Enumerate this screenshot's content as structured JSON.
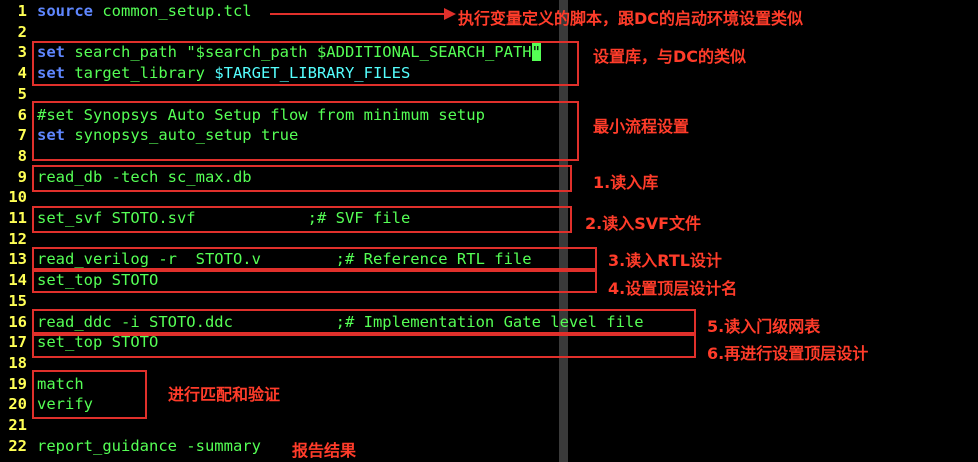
{
  "lines": [
    {
      "num": "1",
      "kw": "source",
      "text": " common_setup.tcl"
    },
    {
      "num": "2"
    },
    {
      "num": "3",
      "kw": "set",
      "text": " search_path ",
      "str": "\"$search_path $ADDITIONAL_SEARCH_PATH",
      "cursor": "\""
    },
    {
      "num": "4",
      "kw": "set",
      "text": " target_library ",
      "var": "$TARGET_LIBRARY_FILES"
    },
    {
      "num": "5"
    },
    {
      "num": "6",
      "text": "#set Synopsys Auto Setup flow from minimum setup"
    },
    {
      "num": "7",
      "kw": "set",
      "text": " synopsys_auto_setup true"
    },
    {
      "num": "8"
    },
    {
      "num": "9",
      "text": "read_db -tech sc_max.db"
    },
    {
      "num": "10"
    },
    {
      "num": "11",
      "text": "set_svf STOTO.svf            ;# SVF file"
    },
    {
      "num": "12"
    },
    {
      "num": "13",
      "text": "read_verilog -r  STOTO.v        ;# Reference RTL file"
    },
    {
      "num": "14",
      "text": "set_top STOTO"
    },
    {
      "num": "15"
    },
    {
      "num": "16",
      "text": "read_ddc -i STOTO.ddc           ;# Implementation Gate level file"
    },
    {
      "num": "17",
      "text": "set_top STOTO"
    },
    {
      "num": "18"
    },
    {
      "num": "19",
      "text": "match"
    },
    {
      "num": "20",
      "text": "verify"
    },
    {
      "num": "21"
    },
    {
      "num": "22",
      "text": "report_guidance -summary"
    }
  ],
  "annotations": {
    "a1": "执行变量定义的脚本，跟DC的启动环境设置类似",
    "a3": "设置库，与DC的类似",
    "a6": "最小流程设置",
    "a9": "1.读入库",
    "a11": "2.读入SVF文件",
    "a13": "3.读入RTL设计",
    "a14": "4.设置顶层设计名",
    "a16": "5.读入门级网表",
    "a17": "6.再进行设置顶层设计",
    "a19": "进行匹配和验证",
    "a22": "报告结果"
  }
}
